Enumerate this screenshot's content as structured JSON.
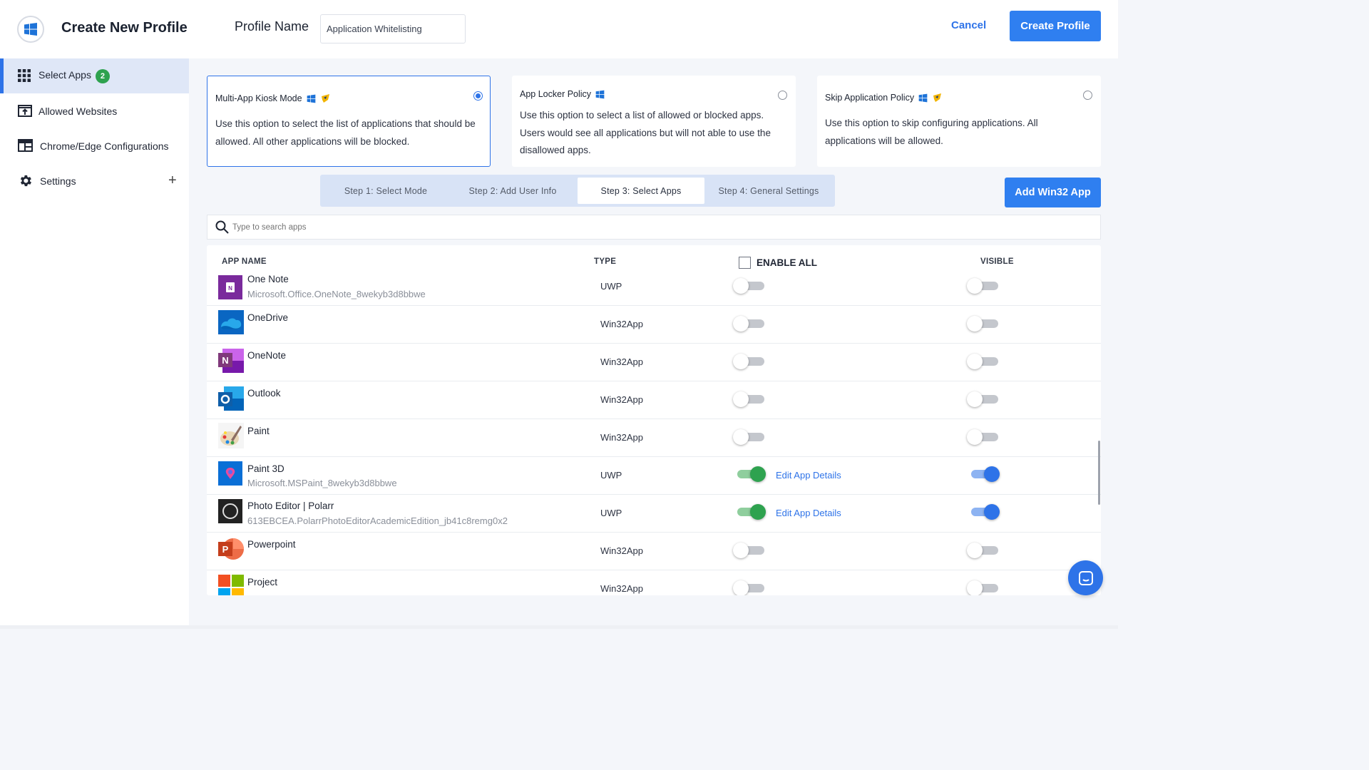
{
  "header": {
    "title": "Create New Profile",
    "profile_name_label": "Profile Name",
    "profile_name_value": "Application Whitelisting",
    "cancel_label": "Cancel",
    "create_label": "Create Profile"
  },
  "sidebar": {
    "items": [
      {
        "label": "Select Apps",
        "badge": "2",
        "icon": "grid-icon",
        "active": true
      },
      {
        "label": "Allowed Websites",
        "icon": "upload-window-icon"
      },
      {
        "label": "Chrome/Edge Configurations",
        "icon": "browser-window-icon"
      },
      {
        "label": "Settings",
        "icon": "gear-icon",
        "expand": "+"
      }
    ]
  },
  "modes": [
    {
      "title": "Multi-App Kiosk Mode",
      "description": "Use this option to select the list of applications that should be allowed. All other applications will be blocked.",
      "selected": true
    },
    {
      "title": "App Locker Policy",
      "description": "Use this option to select a list of allowed or blocked apps. Users would see all applications but will not able to use the disallowed apps.",
      "selected": false
    },
    {
      "title": "Skip Application Policy",
      "description": "Use this option to skip configuring applications. All applications will be allowed.",
      "selected": false
    }
  ],
  "steps": [
    "Step 1: Select Mode",
    "Step 2: Add User Info",
    "Step 3: Select Apps",
    "Step 4: General Settings"
  ],
  "active_step": 2,
  "add_win32_label": "Add Win32 App",
  "search": {
    "placeholder": "Type to search apps"
  },
  "table": {
    "columns": {
      "app_name": "APP NAME",
      "type": "TYPE",
      "enable_all": "ENABLE ALL",
      "visible": "VISIBLE"
    },
    "edit_label": "Edit App Details",
    "rows": [
      {
        "name": "One Note",
        "package": "Microsoft.Office.OneNote_8wekyb3d8bbwe",
        "type": "UWP",
        "enabled": false,
        "visible": false,
        "icon": "onenote-uwp-icon"
      },
      {
        "name": "OneDrive",
        "package": "",
        "type": "Win32App",
        "enabled": false,
        "visible": false,
        "icon": "onedrive-icon"
      },
      {
        "name": "OneNote",
        "package": "",
        "type": "Win32App",
        "enabled": false,
        "visible": false,
        "icon": "onenote-icon"
      },
      {
        "name": "Outlook",
        "package": "",
        "type": "Win32App",
        "enabled": false,
        "visible": false,
        "icon": "outlook-icon"
      },
      {
        "name": "Paint",
        "package": "",
        "type": "Win32App",
        "enabled": false,
        "visible": false,
        "icon": "paint-icon"
      },
      {
        "name": "Paint 3D",
        "package": "Microsoft.MSPaint_8wekyb3d8bbwe",
        "type": "UWP",
        "enabled": true,
        "visible": true,
        "icon": "paint3d-icon"
      },
      {
        "name": "Photo Editor | Polarr",
        "package": "613EBCEA.PolarrPhotoEditorAcademicEdition_jb41c8remg0x2",
        "type": "UWP",
        "enabled": true,
        "visible": true,
        "icon": "polarr-icon"
      },
      {
        "name": "Powerpoint",
        "package": "",
        "type": "Win32App",
        "enabled": false,
        "visible": false,
        "icon": "powerpoint-icon"
      },
      {
        "name": "Project",
        "package": "",
        "type": "Win32App",
        "enabled": false,
        "visible": false,
        "icon": "project-icon"
      }
    ]
  },
  "colors": {
    "accent": "#2e73e8",
    "enabled_green": "#2ea24f",
    "badge_green": "#2ea24f"
  }
}
